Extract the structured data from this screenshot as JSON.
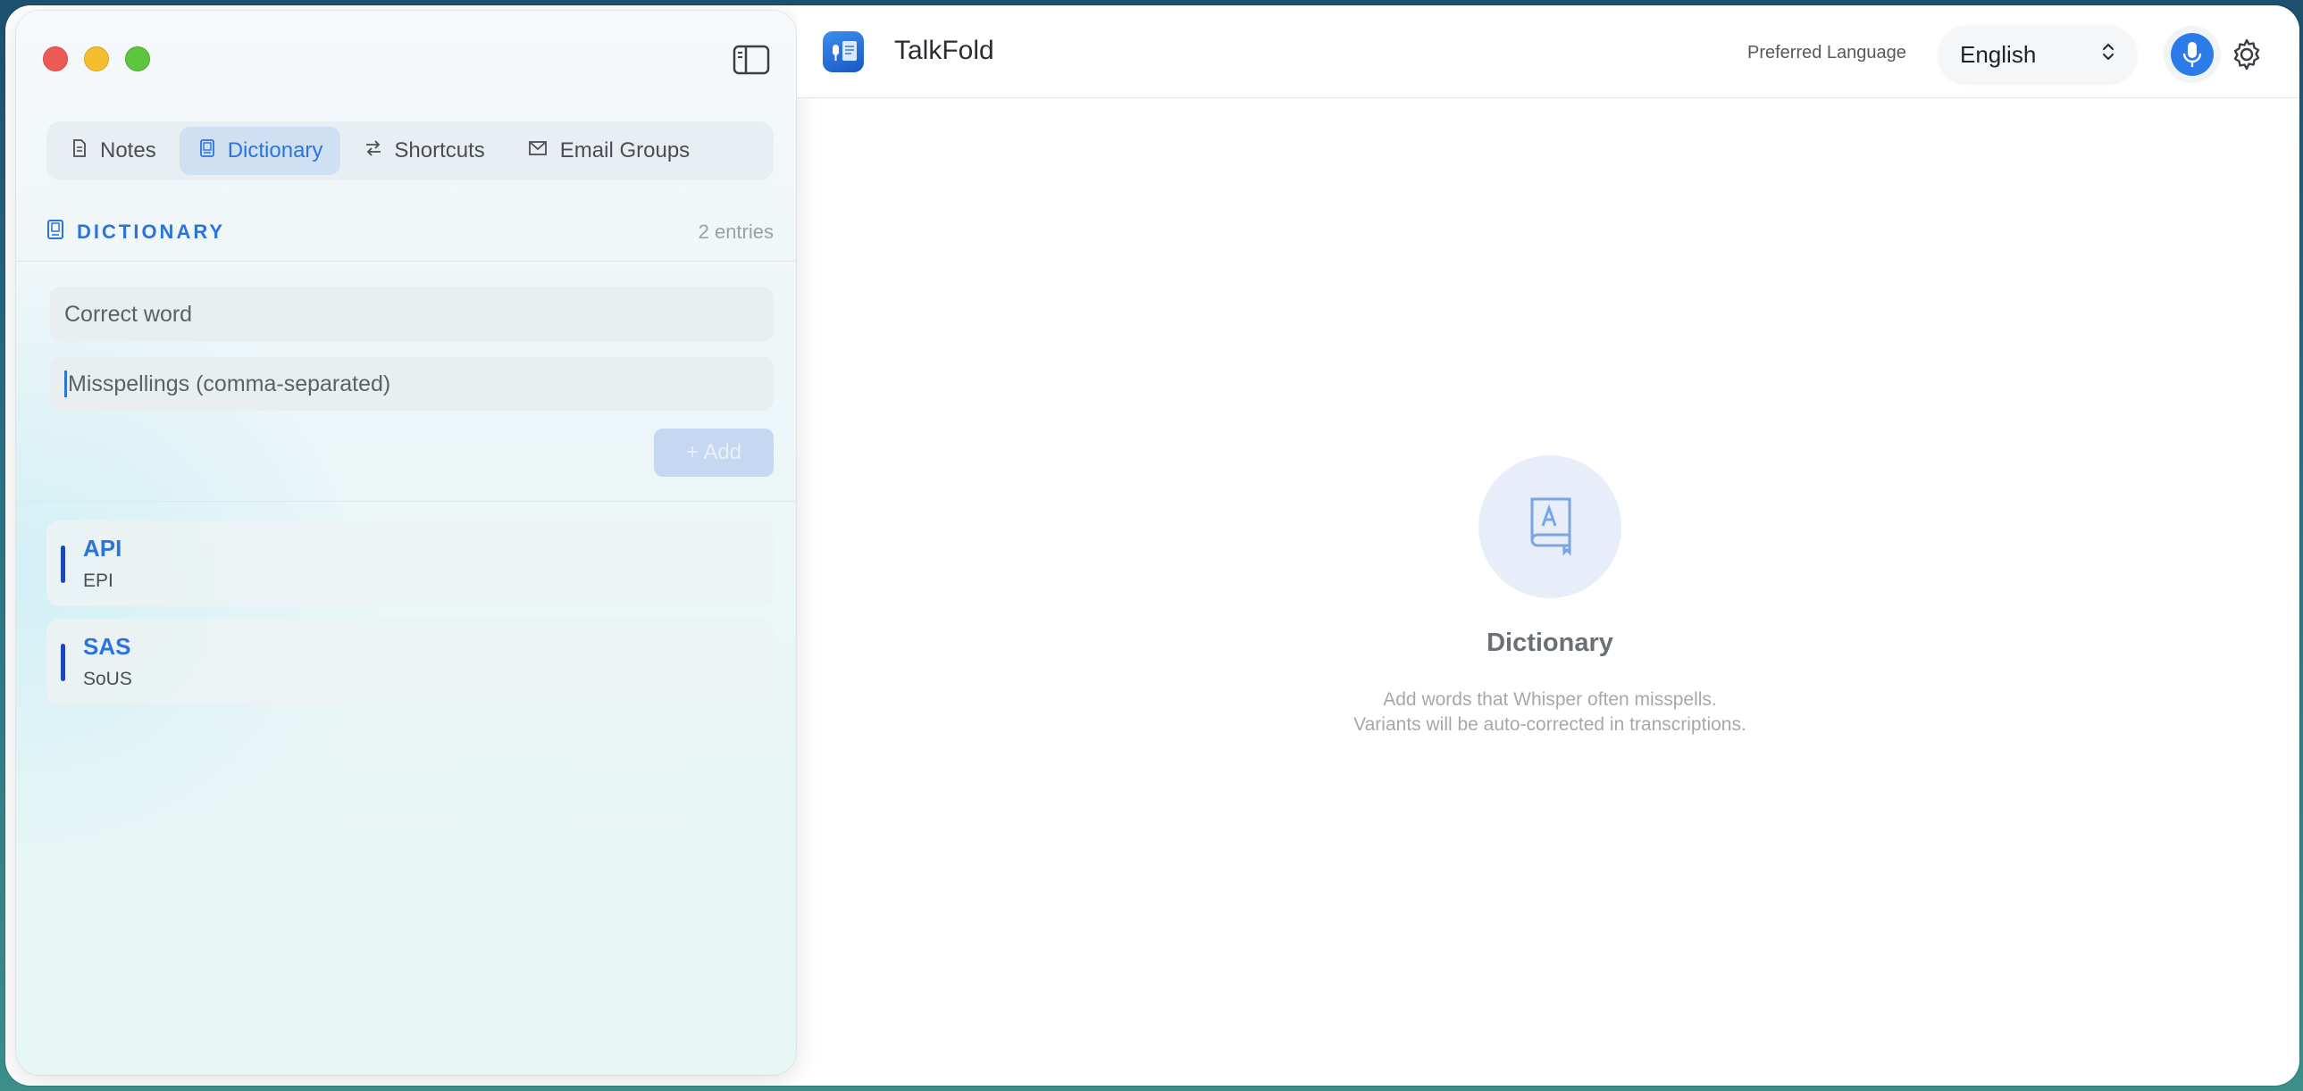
{
  "app": {
    "title": "TalkFold"
  },
  "header": {
    "preferred_language_label": "Preferred Language",
    "language_value": "English"
  },
  "sidebar": {
    "tabs": [
      {
        "label": "Notes",
        "icon": "document-icon",
        "active": false
      },
      {
        "label": "Dictionary",
        "icon": "book-icon",
        "active": true
      },
      {
        "label": "Shortcuts",
        "icon": "arrows-icon",
        "active": false
      },
      {
        "label": "Email Groups",
        "icon": "envelope-icon",
        "active": false
      }
    ],
    "section": {
      "title": "DICTIONARY",
      "count": "2 entries"
    },
    "form": {
      "correct_placeholder": "Correct word",
      "misspellings_placeholder": "Misspellings (comma-separated)",
      "add_label": "+ Add"
    },
    "entries": [
      {
        "word": "API",
        "variants": "EPI"
      },
      {
        "word": "SAS",
        "variants": "SoUS"
      }
    ]
  },
  "empty_state": {
    "title": "Dictionary",
    "desc_line1": "Add words that Whisper often misspells.",
    "desc_line2": "Variants will be auto-corrected in transcriptions."
  },
  "colors": {
    "accent": "#2d73dc",
    "entry_bar": "#1f46b8",
    "mic": "#2b7be8"
  }
}
